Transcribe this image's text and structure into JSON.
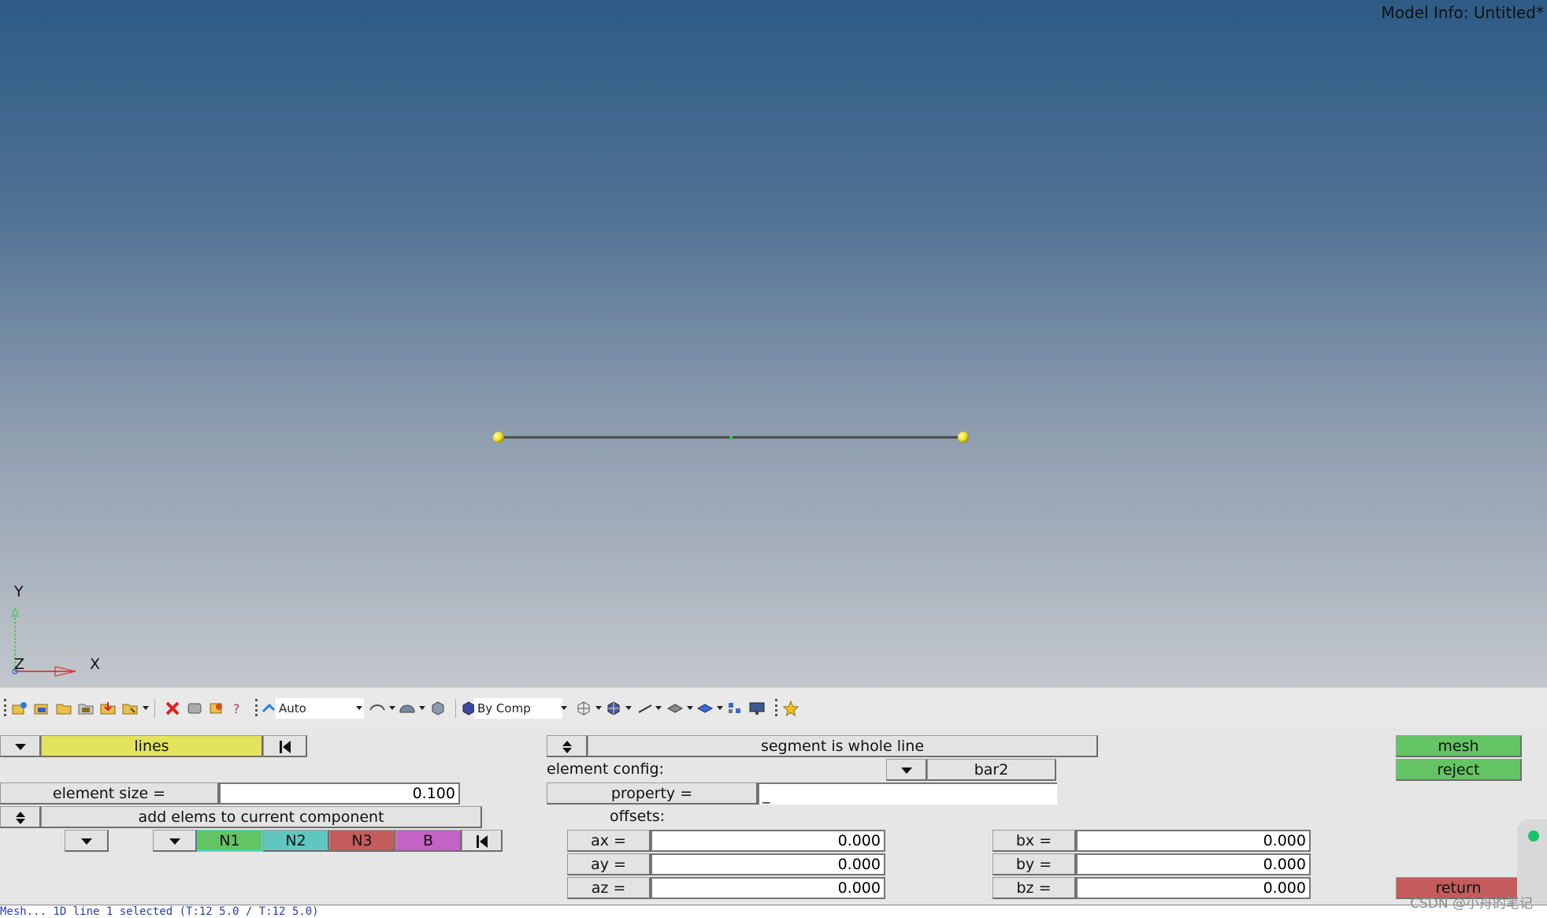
{
  "viewport": {
    "model_info": "Model Info: Untitled*",
    "axes": {
      "x": "X",
      "y": "Y",
      "z": "Z"
    },
    "colors": {
      "line": "#4a4a4a",
      "node": "#f2e22b"
    }
  },
  "toolbar": {
    "file_icons": [
      "new-model-icon",
      "open-model-icon",
      "open-folder-icon",
      "import-icon",
      "export-icon",
      "export-menu-icon"
    ],
    "edit_icons": [
      "delete-icon",
      "mask-icon",
      "find-icon",
      "numbers-icon"
    ],
    "visual_select": {
      "value": "Auto"
    },
    "color_select": {
      "value": "By Comp"
    },
    "view_icons": [
      "surface-display-icon",
      "shaded-surface-icon",
      "solid-display-icon",
      "wireframe-icon",
      "shaded-elements-icon",
      "line-display-icon",
      "plane-display-icon",
      "element-display-icon",
      "connectors-icon",
      "display-monitor-icon",
      "favorite-star-icon"
    ]
  },
  "panel": {
    "lines_selector": "lines",
    "segment_option": "segment is whole line",
    "element_config_label": "element config:",
    "element_config_value": "bar2",
    "element_size_label": "element size =",
    "element_size_value": "0.100",
    "property_label": "property =",
    "property_value": "_",
    "component_option": "add elems to current component",
    "offsets_label": "offsets:",
    "orientation_buttons": [
      {
        "label": "N1",
        "color": "#63c463"
      },
      {
        "label": "N2",
        "color": "#5fc6c0"
      },
      {
        "label": "N3",
        "color": "#c45c5c"
      },
      {
        "label": "B",
        "color": "#c562c5"
      }
    ],
    "offsets_a": [
      {
        "label": "ax =",
        "value": "0.000"
      },
      {
        "label": "ay =",
        "value": "0.000"
      },
      {
        "label": "az =",
        "value": "0.000"
      }
    ],
    "offsets_b": [
      {
        "label": "bx =",
        "value": "0.000"
      },
      {
        "label": "by =",
        "value": "0.000"
      },
      {
        "label": "bz =",
        "value": "0.000"
      }
    ],
    "mesh_button": "mesh",
    "reject_button": "reject",
    "return_button": "return",
    "colors": {
      "lines_yellow": "#e3e35c",
      "green": "#63c463",
      "red": "#c45c5c"
    }
  },
  "status_bar": {
    "text": "Mesh... 1D line 1 selected (T:12 5.0 / T:12 5.0)"
  },
  "watermark": "CSDN @小舟的笔记"
}
